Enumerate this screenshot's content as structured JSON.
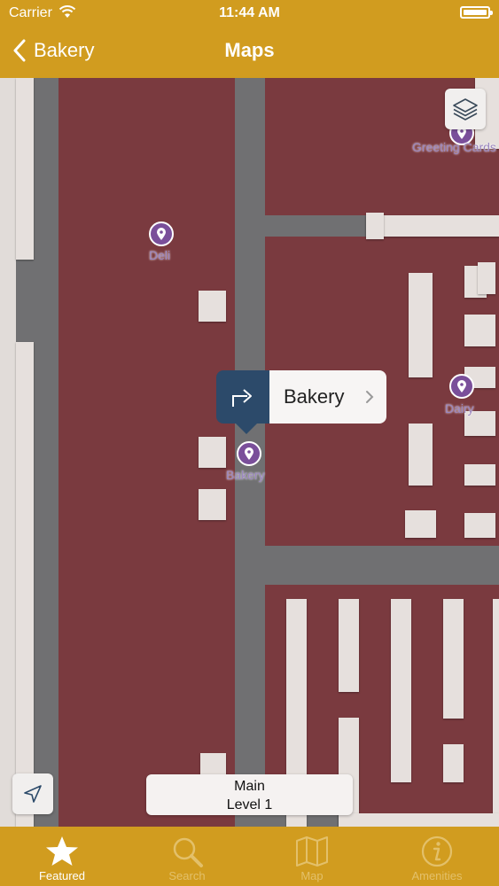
{
  "status": {
    "carrier": "Carrier",
    "time": "11:44 AM"
  },
  "nav": {
    "back_label": "Bakery",
    "title": "Maps"
  },
  "map": {
    "pois": [
      {
        "label": "Greeting Cards"
      },
      {
        "label": "Deli"
      },
      {
        "label": "Dairy"
      },
      {
        "label": "Bakery"
      }
    ],
    "callout": {
      "label": "Bakery"
    },
    "level": {
      "line1": "Main",
      "line2": "Level 1"
    }
  },
  "tabs": [
    {
      "label": "Featured",
      "icon": "star-icon",
      "active": true
    },
    {
      "label": "Search",
      "icon": "search-icon",
      "active": false
    },
    {
      "label": "Map",
      "icon": "map-icon",
      "active": false
    },
    {
      "label": "Amenities",
      "icon": "info-icon",
      "active": false
    }
  ],
  "colors": {
    "bar": "#d19c1f",
    "floor": "#7a3a3f",
    "aisle": "#707072",
    "poi": "#7a4f9a",
    "callout_dir": "#2c4a6a"
  }
}
